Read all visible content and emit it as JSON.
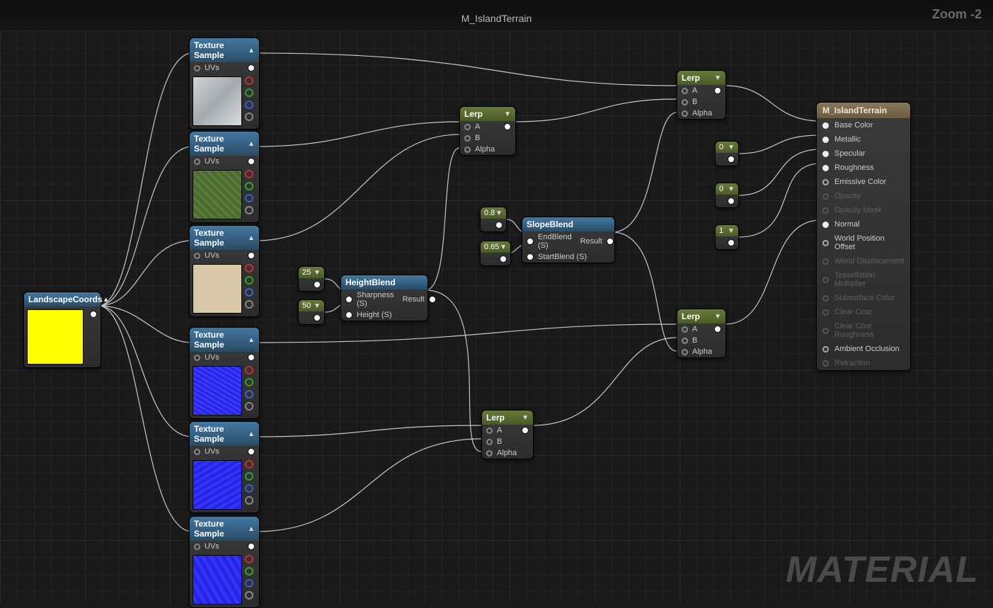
{
  "graph_title": "M_IslandTerrain",
  "zoom_label": "Zoom -2",
  "watermark": "MATERIAL",
  "landscape": {
    "title": "LandscapeCoords"
  },
  "texlabel": "Texture Sample",
  "uvs_label": "UVs",
  "lerp": {
    "title": "Lerp",
    "inA": "A",
    "inB": "B",
    "inAlpha": "Alpha"
  },
  "heightblend": {
    "title": "HeightBlend",
    "sharp": "Sharpness (S)",
    "height": "Height (S)",
    "res": "Result"
  },
  "slopeblend": {
    "title": "SlopeBlend",
    "end": "EndBlend (S)",
    "start": "StartBlend (S)",
    "res": "Result"
  },
  "consts": {
    "c25": "25",
    "c50": "50",
    "c08": "0.8",
    "c065": "0.65",
    "c0a": "0",
    "c0b": "0",
    "c1": "1"
  },
  "result": {
    "title": "M_IslandTerrain",
    "pins": [
      {
        "label": "Base Color",
        "on": true
      },
      {
        "label": "Metallic",
        "on": true
      },
      {
        "label": "Specular",
        "on": true
      },
      {
        "label": "Roughness",
        "on": true
      },
      {
        "label": "Emissive Color",
        "on": false
      },
      {
        "label": "Opacity",
        "disabled": true
      },
      {
        "label": "Opacity Mask",
        "disabled": true
      },
      {
        "label": "Normal",
        "on": true
      },
      {
        "label": "World Position Offset",
        "on": false
      },
      {
        "label": "World Displacement",
        "disabled": true
      },
      {
        "label": "Tessellation Multiplier",
        "disabled": true
      },
      {
        "label": "Subsurface Color",
        "disabled": true
      },
      {
        "label": "Clear Coat",
        "disabled": true
      },
      {
        "label": "Clear Coat Roughness",
        "disabled": true
      },
      {
        "label": "Ambient Occlusion",
        "on": false
      },
      {
        "label": "Refraction",
        "disabled": true
      }
    ]
  }
}
